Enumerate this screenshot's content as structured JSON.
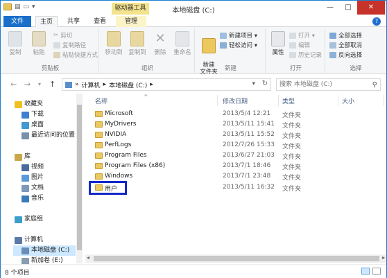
{
  "window": {
    "title": "本地磁盘 (C:)",
    "context_tab_group": "驱动器工具",
    "controls": {
      "minimize": "—",
      "maximize": "□",
      "close": "✕"
    }
  },
  "tabs": {
    "file": "文件",
    "home": "主页",
    "share": "共享",
    "view": "查看",
    "manage": "管理",
    "help": "?"
  },
  "ribbon": {
    "clipboard": {
      "label": "剪贴板",
      "copy": "复制",
      "paste": "粘贴",
      "cut": "剪切",
      "copy_path": "复制路径",
      "paste_shortcut": "粘贴快捷方式"
    },
    "organize": {
      "label": "组织",
      "move_to": "移动到",
      "copy_to": "复制到",
      "delete": "删除",
      "rename": "重命名"
    },
    "new": {
      "label": "新建",
      "new_folder": "新建\n文件夹",
      "new_item": "新建项目 ▾",
      "easy_access": "轻松访问 ▾"
    },
    "open": {
      "label": "打开",
      "properties": "属性",
      "open": "打开 ▾",
      "edit": "编辑",
      "history": "历史记录"
    },
    "select": {
      "label": "选择",
      "select_all": "全部选择",
      "select_none": "全部取消",
      "invert": "反向选择"
    }
  },
  "address": {
    "back": "←",
    "forward": "→",
    "recent": "▾",
    "up": "↑",
    "crumb_root": "»",
    "crumb_computer": "计算机",
    "crumb_sep": "▸",
    "crumb_drive": "本地磁盘 (C:)",
    "crumb_drive_sep": "▸",
    "dropdown": "▾",
    "refresh": "↻",
    "search_placeholder": "搜索 本地磁盘 (C:)",
    "search_glyph": "⚲"
  },
  "nav_pane": {
    "items": [
      {
        "label": "收藏夹",
        "icon": "star-icon",
        "color": "#f0c020"
      },
      {
        "label": "下载",
        "icon": "download-folder-icon",
        "color": "#3f7fd0"
      },
      {
        "label": "桌面",
        "icon": "desktop-icon",
        "color": "#3f9ad0"
      },
      {
        "label": "最近访问的位置",
        "icon": "recent-places-icon",
        "color": "#7a8fa8"
      },
      {
        "label": "库",
        "icon": "library-icon",
        "color": "#c8a848"
      },
      {
        "label": "视频",
        "icon": "video-icon",
        "color": "#4c6aa0"
      },
      {
        "label": "图片",
        "icon": "pictures-icon",
        "color": "#5a9ad8"
      },
      {
        "label": "文档",
        "icon": "documents-icon",
        "color": "#7d98b8"
      },
      {
        "label": "音乐",
        "icon": "music-icon",
        "color": "#3a7ab8"
      },
      {
        "label": "家庭组",
        "icon": "homegroup-icon",
        "color": "#3aa0c8"
      },
      {
        "label": "计算机",
        "icon": "computer-icon",
        "color": "#5a7aa8"
      },
      {
        "label": "本地磁盘 (C:)",
        "icon": "drive-c-icon",
        "color": "#6a8cb8"
      },
      {
        "label": "新加卷 (E:)",
        "icon": "drive-e-icon",
        "color": "#8a9cb0"
      }
    ]
  },
  "columns": {
    "name": "名称",
    "date": "修改日期",
    "type": "类型",
    "size": "大小",
    "sort_indicator": "^"
  },
  "files": [
    {
      "name": "Microsoft",
      "date": "2013/5/4 12:21",
      "type": "文件夹"
    },
    {
      "name": "MyDrivers",
      "date": "2013/5/11 15:41",
      "type": "文件夹"
    },
    {
      "name": "NVIDIA",
      "date": "2013/5/11 15:52",
      "type": "文件夹"
    },
    {
      "name": "PerfLogs",
      "date": "2012/7/26 15:33",
      "type": "文件夹"
    },
    {
      "name": "Program Files",
      "date": "2013/6/27 21:03",
      "type": "文件夹"
    },
    {
      "name": "Program Files (x86)",
      "date": "2013/7/1 18:46",
      "type": "文件夹"
    },
    {
      "name": "Windows",
      "date": "2013/7/1 23:48",
      "type": "文件夹"
    },
    {
      "name": "用户",
      "date": "2013/5/11 16:32",
      "type": "文件夹"
    }
  ],
  "status": {
    "item_count": "8 个项目"
  },
  "colors": {
    "accent": "#1a6fc9",
    "highlight_box": "#1428c8",
    "folder": "#ebc95e"
  }
}
